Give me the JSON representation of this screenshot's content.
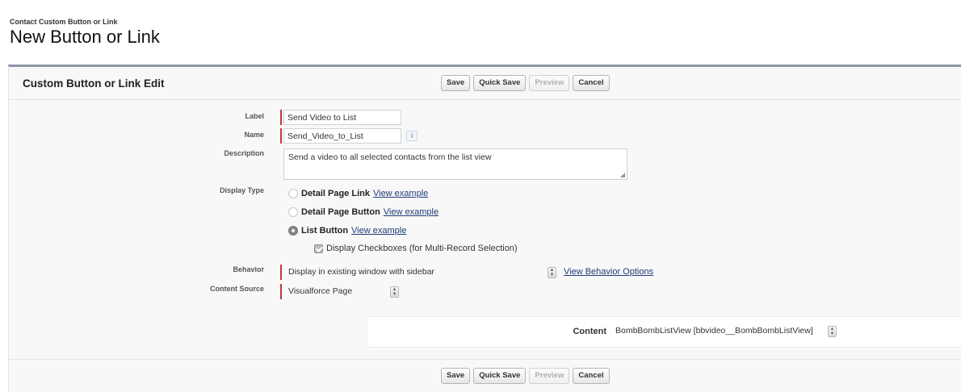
{
  "header": {
    "breadcrumb": "Contact Custom Button or Link",
    "title": "New Button or Link"
  },
  "section": {
    "title": "Custom Button or Link Edit"
  },
  "buttons": {
    "save": "Save",
    "quick_save": "Quick Save",
    "preview": "Preview",
    "cancel": "Cancel"
  },
  "form": {
    "label": {
      "label": "Label",
      "value": "Send Video to List"
    },
    "name": {
      "label": "Name",
      "value": "Send_Video_to_List",
      "info_icon": "i"
    },
    "description": {
      "label": "Description",
      "value": "Send a video to all selected contacts from the list view"
    },
    "display_type": {
      "label": "Display Type",
      "options": [
        {
          "label": "Detail Page Link",
          "link": "View example",
          "selected": false
        },
        {
          "label": "Detail Page Button",
          "link": "View example",
          "selected": false
        },
        {
          "label": "List Button",
          "link": "View example",
          "selected": true
        }
      ],
      "checkbox_label": "Display Checkboxes (for Multi-Record Selection)",
      "checkbox_checked": true
    },
    "behavior": {
      "label": "Behavior",
      "value": "Display in existing window with sidebar",
      "link": "View Behavior Options"
    },
    "content_source": {
      "label": "Content Source",
      "value": "Visualforce Page"
    },
    "content": {
      "label": "Content",
      "value": "BombBombListView [bbvideo__BombBombListView]"
    }
  },
  "colors": {
    "required_bar": "#c23934",
    "header_rule": "#8f94a8",
    "link": "#1f3b7a"
  }
}
